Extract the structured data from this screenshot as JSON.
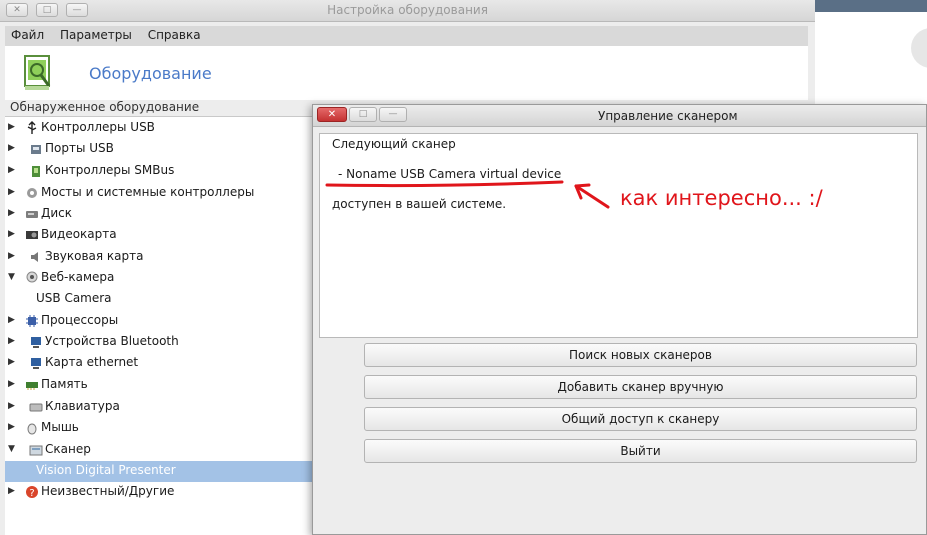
{
  "main_window": {
    "title": "Настройка оборудования",
    "menu": [
      "Файл",
      "Параметры",
      "Справка"
    ],
    "header_title": "Оборудование",
    "group_label": "Обнаруженное оборудование"
  },
  "tree": {
    "items": [
      {
        "label": "Контроллеры USB",
        "arrow": "▶",
        "icon": "usb-icon",
        "level": 0
      },
      {
        "label": "Порты USB",
        "arrow": "▶",
        "icon": "usb-port-icon",
        "level": 0
      },
      {
        "label": "Контроллеры SMBus",
        "arrow": "▶",
        "icon": "chip-icon",
        "level": 0
      },
      {
        "label": "Мосты и системные контроллеры",
        "arrow": "▶",
        "icon": "gear-icon",
        "level": 0
      },
      {
        "label": "Диск",
        "arrow": "▶",
        "icon": "disk-icon",
        "level": 0
      },
      {
        "label": "Видеокарта",
        "arrow": "▶",
        "icon": "video-card-icon",
        "level": 0
      },
      {
        "label": "Звуковая карта",
        "arrow": "▶",
        "icon": "speaker-icon",
        "level": 0
      },
      {
        "label": "Веб-камера",
        "arrow": "▼",
        "icon": "webcam-icon",
        "level": 0
      },
      {
        "label": "USB Camera",
        "arrow": "",
        "icon": "",
        "level": 1
      },
      {
        "label": "Процессоры",
        "arrow": "▶",
        "icon": "cpu-icon",
        "level": 0
      },
      {
        "label": "Устройства Bluetooth",
        "arrow": "▶",
        "icon": "bluetooth-device-icon",
        "level": 0
      },
      {
        "label": "Карта ethernet",
        "arrow": "▶",
        "icon": "network-card-icon",
        "level": 0
      },
      {
        "label": "Память",
        "arrow": "▶",
        "icon": "memory-icon",
        "level": 0
      },
      {
        "label": "Клавиатура",
        "arrow": "▶",
        "icon": "keyboard-icon",
        "level": 0
      },
      {
        "label": "Мышь",
        "arrow": "▶",
        "icon": "mouse-icon",
        "level": 0
      },
      {
        "label": "Сканер",
        "arrow": "▼",
        "icon": "scanner-icon",
        "level": 0
      },
      {
        "label": "Vision Digital Presenter",
        "arrow": "",
        "icon": "",
        "level": 1,
        "selected": true
      },
      {
        "label": "Неизвестный/Другие",
        "arrow": "▶",
        "icon": "unknown-icon",
        "level": 0
      }
    ]
  },
  "dialog": {
    "title": "Управление сканером",
    "close_glyph": "✕",
    "max_glyph": "□",
    "min_glyph": "—",
    "text_line1": "Следующий сканер",
    "text_line2": "-  Noname USB Camera virtual device",
    "text_line3": "доступен в вашей системе.",
    "buttons": [
      "Поиск новых сканеров",
      "Добавить сканер вручную",
      "Общий доступ к сканеру",
      "Выйти"
    ]
  },
  "annotation": {
    "text": "как интересно... :/",
    "color": "#e0151b"
  },
  "colors": {
    "selection": "#a3c2e6",
    "header_title": "#4a7ac8"
  }
}
